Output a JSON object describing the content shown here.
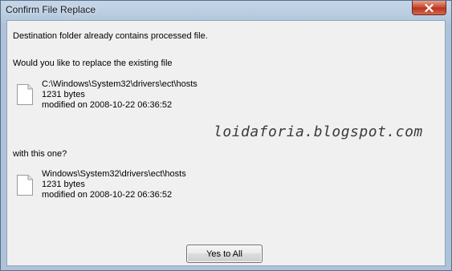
{
  "window": {
    "title": "Confirm File Replace"
  },
  "message": {
    "line1": "Destination folder already contains processed file.",
    "line2": "Would you like to replace the existing file",
    "line3": "with this one?"
  },
  "existing_file": {
    "path": "C:\\Windows\\System32\\drivers\\ect\\hosts",
    "size": "1231 bytes",
    "modified": "modified on 2008-10-22 06:36:52"
  },
  "new_file": {
    "path": "Windows\\System32\\drivers\\ect\\hosts",
    "size": "1231 bytes",
    "modified": "modified on 2008-10-22 06:36:52"
  },
  "watermark": "loidaforia.blogspot.com",
  "buttons": {
    "yes_to_all": "Yes to All"
  },
  "icons": {
    "close": "close-icon",
    "file": "document-icon"
  }
}
